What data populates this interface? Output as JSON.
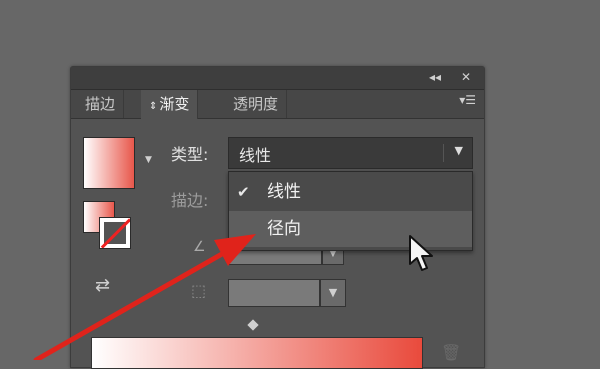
{
  "tabs": [
    {
      "label": "描边"
    },
    {
      "label": "渐变"
    },
    {
      "label": "透明度"
    }
  ],
  "type_label": "类型:",
  "stroke_label": "描边:",
  "type_select": {
    "value": "线性"
  },
  "dropdown": {
    "options": [
      {
        "label": "线性",
        "checked": true
      },
      {
        "label": "径向",
        "checked": false
      }
    ]
  },
  "colors": {
    "gradient_start": "#ffffff",
    "gradient_end": "#e94a3c",
    "annotation_arrow": "#e0231b"
  }
}
